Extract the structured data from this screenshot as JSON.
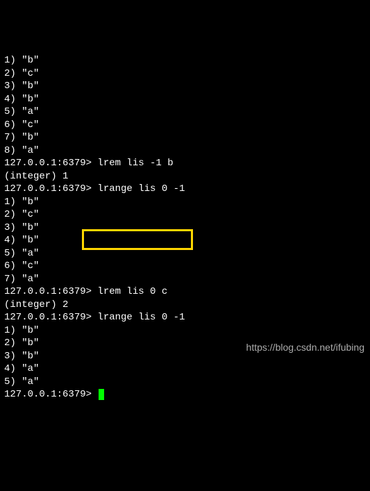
{
  "blocks": [
    {
      "type": "list",
      "items": [
        "\"b\"",
        "\"c\"",
        "\"b\"",
        "\"b\"",
        "\"a\"",
        "\"c\"",
        "\"b\"",
        "\"a\""
      ]
    },
    {
      "type": "cmd",
      "prompt": "127.0.0.1:6379>",
      "command": "lrem lis -1 b"
    },
    {
      "type": "out",
      "text": "(integer) 1"
    },
    {
      "type": "cmd",
      "prompt": "127.0.0.1:6379>",
      "command": "lrange lis 0 -1"
    },
    {
      "type": "list",
      "items": [
        "\"b\"",
        "\"c\"",
        "\"b\"",
        "\"b\"",
        "\"a\"",
        "\"c\"",
        "\"a\""
      ]
    },
    {
      "type": "cmd",
      "prompt": "127.0.0.1:6379>",
      "command": "lrem lis 0 c",
      "highlight": true,
      "hx": 118,
      "hw": 160,
      "hh": 30
    },
    {
      "type": "out",
      "text": "(integer) 2"
    },
    {
      "type": "cmd",
      "prompt": "127.0.0.1:6379>",
      "command": "lrange lis 0 -1"
    },
    {
      "type": "list",
      "items": [
        "\"b\"",
        "\"b\"",
        "\"b\"",
        "\"a\"",
        "\"a\""
      ]
    },
    {
      "type": "cmd",
      "prompt": "127.0.0.1:6379>",
      "command": "",
      "cursor": true
    }
  ],
  "watermark": "https://blog.csdn.net/ifubing"
}
